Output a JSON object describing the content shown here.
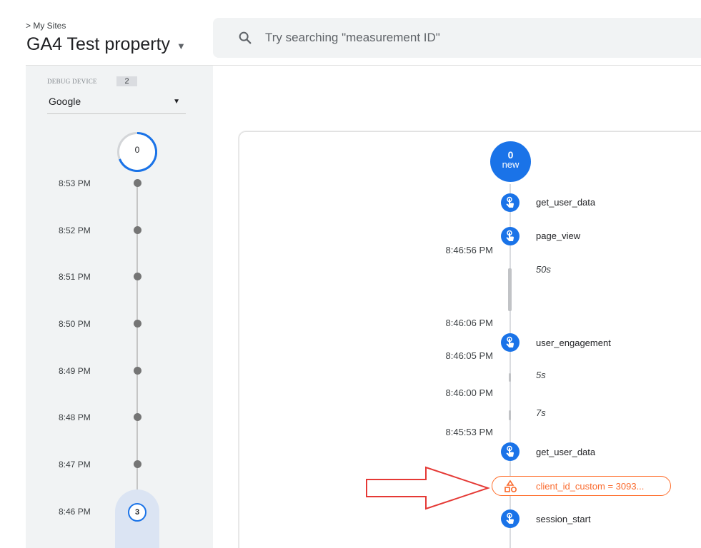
{
  "header": {
    "breadcrumb": "> My Sites",
    "property_name": "GA4 Test property",
    "search_placeholder": "Try searching \"measurement ID\""
  },
  "sidebar": {
    "debug_device_label": "DEBUG DEVICE",
    "debug_device_count": "2",
    "device_selected": "Google",
    "top_count": "0",
    "minutes": [
      "8:53 PM",
      "8:52 PM",
      "8:51 PM",
      "8:50 PM",
      "8:49 PM",
      "8:48 PM",
      "8:47 PM",
      "8:46 PM"
    ],
    "active_minute_count": "3"
  },
  "stream": {
    "new_count": "0",
    "new_label": "new",
    "events": [
      {
        "name": "get_user_data"
      },
      {
        "name": "page_view"
      },
      {
        "name": "user_engagement"
      },
      {
        "name": "get_user_data"
      },
      {
        "name": "session_start"
      }
    ],
    "timestamps": [
      "8:46:56 PM",
      "8:46:06 PM",
      "8:46:05 PM",
      "8:46:00 PM",
      "8:45:53 PM"
    ],
    "durations": [
      "50s",
      "5s",
      "7s"
    ],
    "user_property": "client_id_custom = 3093..."
  },
  "colors": {
    "accent_blue": "#1a73e8",
    "user_property_orange": "#fa6a2d",
    "callout_arrow_red": "#e53935"
  },
  "icons": {
    "search": "search-icon",
    "event": "touch-event-icon",
    "user_property": "shapes-icon",
    "callout": "arrow-right-icon"
  }
}
